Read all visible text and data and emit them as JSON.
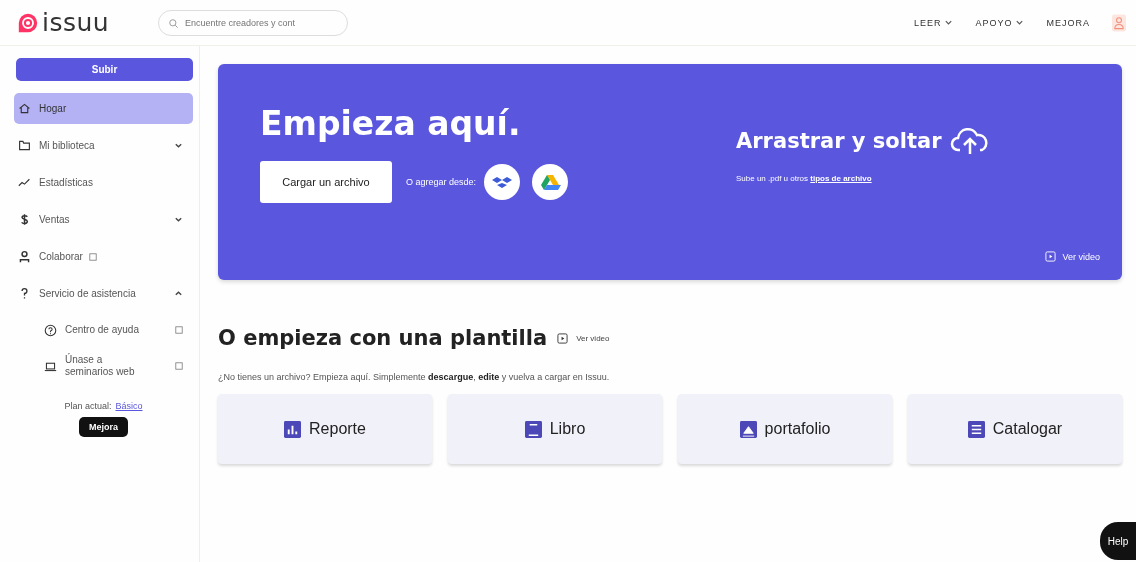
{
  "header": {
    "logo": "issuu",
    "search": {
      "placeholder": "Encuentre creadores y cont"
    },
    "nav": [
      {
        "label": "LEER",
        "dropdown": true
      },
      {
        "label": "APOYO",
        "dropdown": true
      },
      {
        "label": "MEJORA",
        "dropdown": false
      }
    ]
  },
  "sidebar": {
    "upload_button": "Subir",
    "items": [
      {
        "label": "Hogar",
        "selected": true,
        "external": false
      },
      {
        "label": "Mi biblioteca",
        "selected": false,
        "external": false,
        "expanded": false
      },
      {
        "label": "Estadísticas",
        "selected": false,
        "external": false
      },
      {
        "label": "Ventas",
        "selected": false,
        "external": false,
        "expanded": false
      },
      {
        "label": "Colaborar",
        "selected": false,
        "external": true
      },
      {
        "label": "Servicio de asistencia",
        "selected": false,
        "external": false,
        "expanded": true,
        "children": [
          {
            "label": "Centro de ayuda",
            "selected": false,
            "external": true
          },
          {
            "label": "Únase a seminarios web",
            "selected": false,
            "external": true
          }
        ]
      }
    ],
    "plan_label": "Plan actual:",
    "plan_link": "Básico",
    "upgrade_button": "Mejora"
  },
  "hero": {
    "title": "Empieza aquí.",
    "upload_button": "Cargar un archivo",
    "add_from": "O agregar desde:",
    "drag_title": "Arrastrar y soltar",
    "drag_hint": "Sube un .pdf u otros",
    "drag_link": "tipos de archivo",
    "video_link": "Ver video"
  },
  "templates": {
    "title": "O empieza con una plantilla",
    "video_link": "Ver video",
    "description": "¿No tienes un archivo? Empieza aquí. Simplemente **descargue**, **edite** y vuelva a cargar en Issuu.",
    "cards": [
      {
        "label": "Reporte"
      },
      {
        "label": "Libro"
      },
      {
        "label": "portafolio"
      },
      {
        "label": "Catalogar"
      }
    ]
  },
  "help_button": "Help"
}
